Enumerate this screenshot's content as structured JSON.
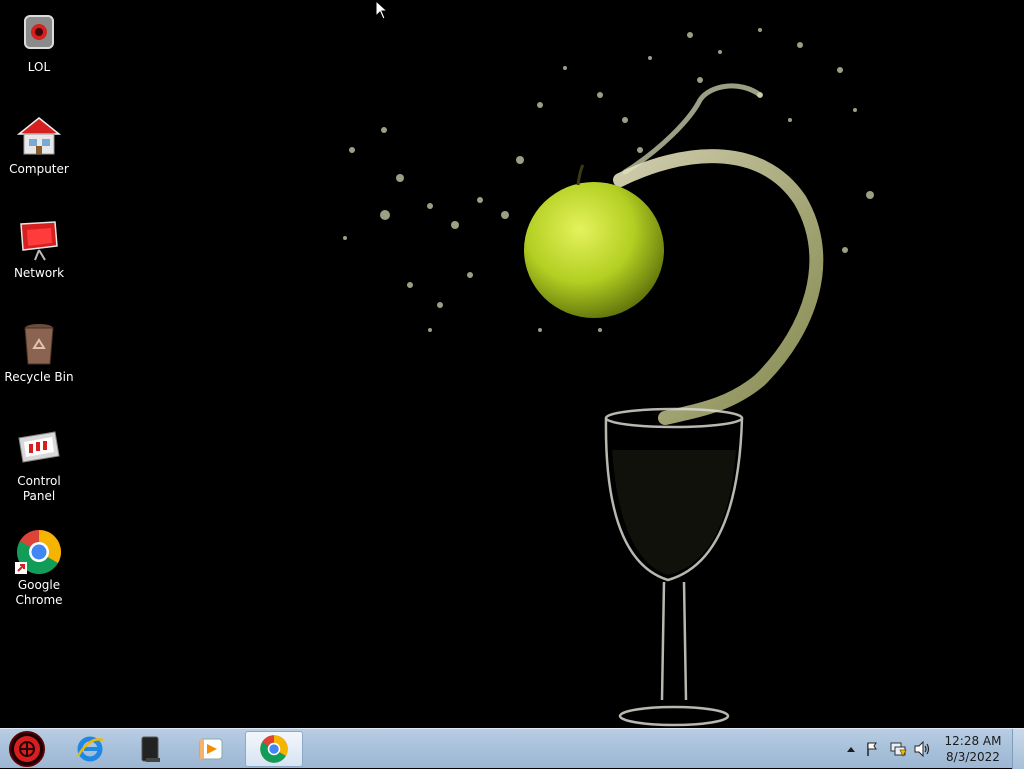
{
  "desktop": {
    "icons": [
      {
        "label": "LOL",
        "icon": "lol-app-icon"
      },
      {
        "label": "Computer",
        "icon": "computer-icon"
      },
      {
        "label": "Network",
        "icon": "network-icon"
      },
      {
        "label": "Recycle Bin",
        "icon": "recycle-bin-icon"
      },
      {
        "label": "Control Panel",
        "icon": "control-panel-icon"
      },
      {
        "label": "Google Chrome",
        "icon": "chrome-icon"
      }
    ],
    "wallpaper": "green apple and splash into wine glass on black"
  },
  "taskbar": {
    "start_icon": "start-orb-icon",
    "pinned": [
      {
        "icon": "internet-explorer-icon",
        "active": false
      },
      {
        "icon": "media-center-icon",
        "active": false
      },
      {
        "icon": "media-player-icon",
        "active": false
      },
      {
        "icon": "chrome-icon",
        "active": true
      }
    ],
    "tray": {
      "icons": [
        "show-hidden-icons-arrow-icon",
        "action-center-flag-icon",
        "network-status-icon",
        "volume-icon"
      ],
      "time": "12:28 AM",
      "date": "8/3/2022"
    }
  },
  "colors": {
    "desktop_bg": "#000000",
    "taskbar": "#aec4dd",
    "accent_red": "#d62020",
    "apple_green": "#b6d32a"
  }
}
